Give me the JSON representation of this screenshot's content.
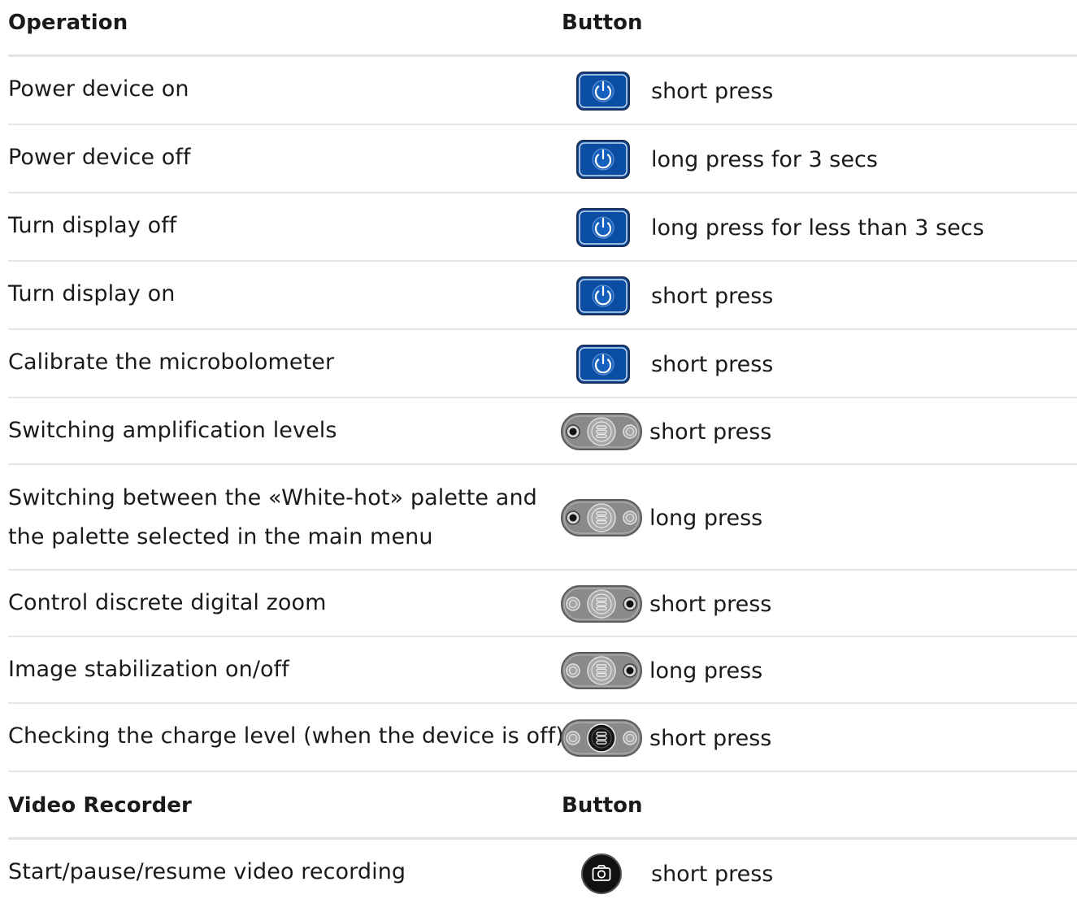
{
  "header": {
    "operation": "Operation",
    "button": "Button"
  },
  "rows": [
    {
      "operation": "Power device on",
      "button": "power-button",
      "press": "short press"
    },
    {
      "operation": "Power device off",
      "button": "power-button",
      "press": "long press for 3 secs"
    },
    {
      "operation": "Turn display off",
      "button": "power-button",
      "press": "long press for less than 3 secs"
    },
    {
      "operation": "Turn display on",
      "button": "power-button",
      "press": "short press"
    },
    {
      "operation": "Calibrate the microbolometer",
      "button": "power-button",
      "press": "short press"
    },
    {
      "operation": "Switching amplification levels",
      "button": "rocker-left-pressed",
      "press": "short press"
    },
    {
      "operation_line1": "Switching between the «White-hot» palette and",
      "operation_line2": "the palette selected in the main menu",
      "button": "rocker-left-pressed",
      "press": "long press"
    },
    {
      "operation": "Control discrete digital zoom",
      "button": "rocker-right-pressed",
      "press": "short press"
    },
    {
      "operation": "Image stabilization on/off",
      "button": "rocker-right-pressed",
      "press": "long press"
    },
    {
      "operation": "Checking the charge level (when the device is off)",
      "button": "rocker-center-pressed",
      "press": "short press"
    }
  ],
  "header2": {
    "operation": "Video Recorder",
    "button": "Button"
  },
  "rec_row": {
    "operation": "Start/pause/resume video recording",
    "button": "camera-button",
    "press": "short press"
  },
  "colors": {
    "power_blue": "#0a4ea3",
    "rocker_gray": "#8c8c8c",
    "divider": "#e6e6e6"
  }
}
